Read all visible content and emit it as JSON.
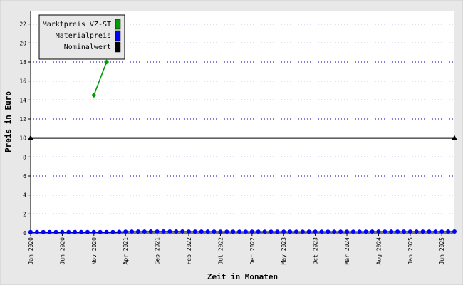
{
  "chart_data": {
    "type": "line",
    "title": "",
    "xlabel": "Zeit in Monaten",
    "ylabel": "Preis in Euro",
    "ylim": [
      0,
      23.4
    ],
    "yticks": [
      0,
      2,
      4,
      6,
      8,
      10,
      12,
      14,
      16,
      18,
      20,
      22
    ],
    "grid": true,
    "legend_position": "top-left",
    "x_start": "Jan 2020",
    "x_end": "Aug 2025",
    "x_tick_labels": [
      "Jan 2020",
      "Jun 2020",
      "Nov 2020",
      "Apr 2021",
      "Sep 2021",
      "Feb 2022",
      "Jul 2022",
      "Dec 2022",
      "May 2023",
      "Oct 2023",
      "Mar 2024",
      "Aug 2024",
      "Jan 2025",
      "Jun 2025"
    ],
    "x_tick_months": [
      0,
      5,
      10,
      15,
      20,
      25,
      30,
      35,
      40,
      45,
      50,
      55,
      60,
      65
    ],
    "series": [
      {
        "name": "Marktpreis VZ-ST",
        "color": "#009900",
        "marker": "diamond",
        "months": [
          10,
          12
        ],
        "values": [
          14.5,
          18
        ]
      },
      {
        "name": "Materialpreis",
        "color": "#0000ff",
        "marker": "circle",
        "months": [
          0,
          1,
          2,
          3,
          4,
          5,
          6,
          7,
          8,
          9,
          10,
          11,
          12,
          13,
          14,
          15,
          16,
          17,
          18,
          19,
          20,
          21,
          22,
          23,
          24,
          25,
          26,
          27,
          28,
          29,
          30,
          31,
          32,
          33,
          34,
          35,
          36,
          37,
          38,
          39,
          40,
          41,
          42,
          43,
          44,
          45,
          46,
          47,
          48,
          49,
          50,
          51,
          52,
          53,
          54,
          55,
          56,
          57,
          58,
          59,
          60,
          61,
          62,
          63,
          64,
          65,
          66,
          67
        ],
        "values": [
          0.09,
          0.09,
          0.09,
          0.09,
          0.09,
          0.09,
          0.09,
          0.09,
          0.09,
          0.09,
          0.09,
          0.09,
          0.09,
          0.09,
          0.11,
          0.13,
          0.14,
          0.14,
          0.14,
          0.15,
          0.15,
          0.15,
          0.15,
          0.15,
          0.15,
          0.14,
          0.14,
          0.14,
          0.14,
          0.14,
          0.13,
          0.13,
          0.13,
          0.13,
          0.13,
          0.13,
          0.13,
          0.13,
          0.13,
          0.13,
          0.13,
          0.13,
          0.13,
          0.13,
          0.13,
          0.13,
          0.13,
          0.13,
          0.13,
          0.13,
          0.13,
          0.13,
          0.13,
          0.13,
          0.14,
          0.14,
          0.14,
          0.14,
          0.14,
          0.14,
          0.14,
          0.14,
          0.14,
          0.14,
          0.14,
          0.14,
          0.15,
          0.15
        ]
      },
      {
        "name": "Nominalwert",
        "color": "#000000",
        "marker": "triangle",
        "months": [
          0,
          67
        ],
        "values": [
          10,
          10
        ]
      }
    ]
  },
  "colors": {
    "frame_background": "#e8e8e8",
    "plot_background": "#ffffff",
    "grid_color": "#0000aa",
    "legend_background": "#e8e8e8"
  }
}
